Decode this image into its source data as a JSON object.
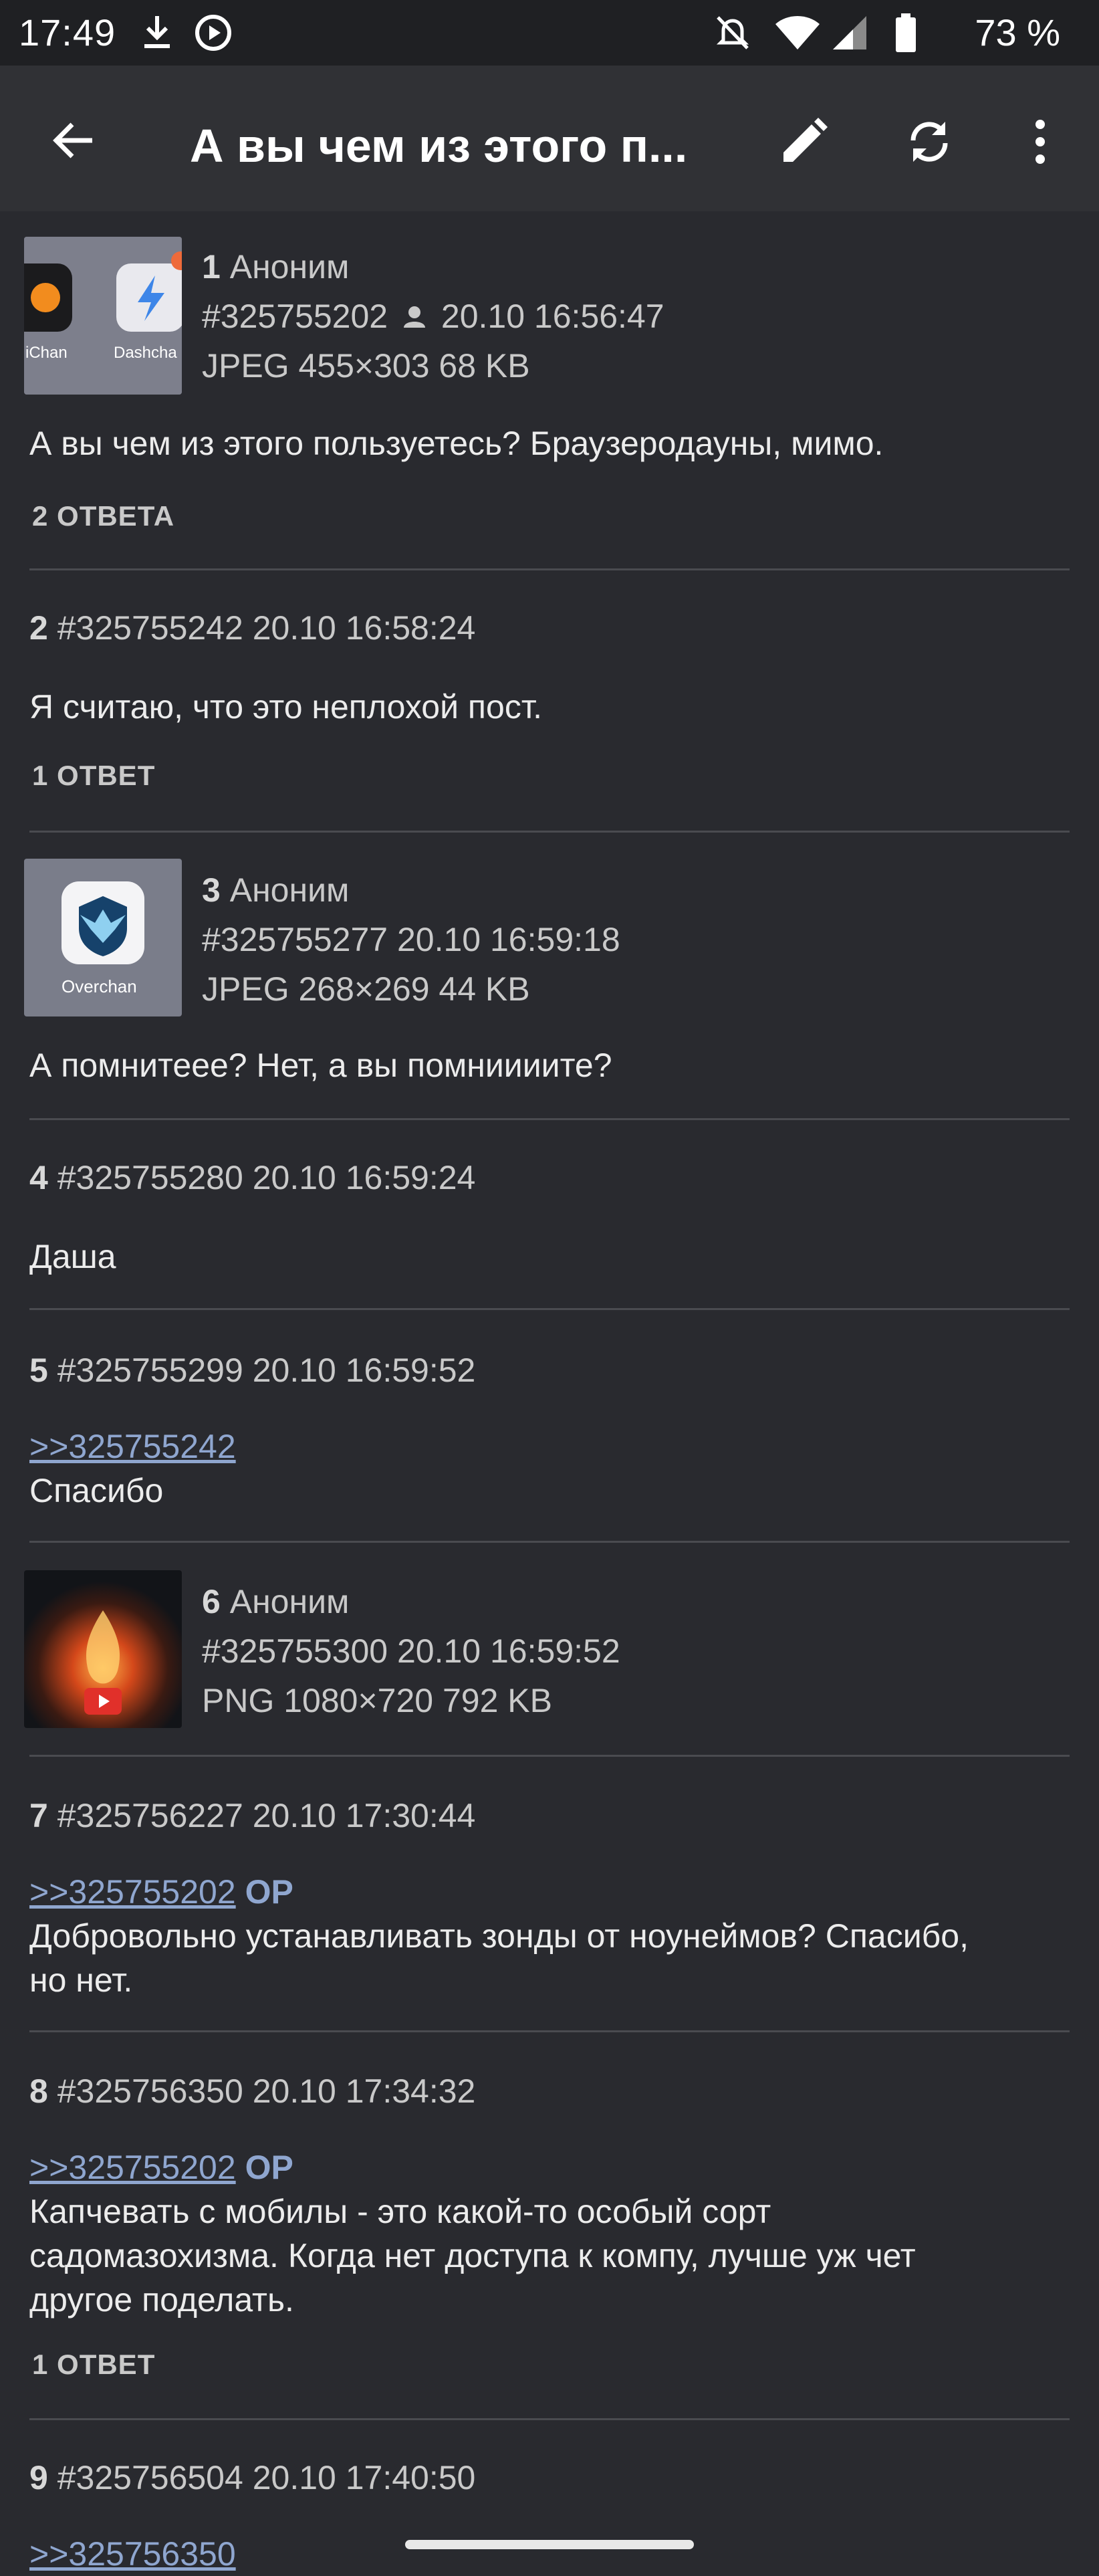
{
  "status_bar": {
    "time": "17:49",
    "battery": "73 %",
    "icons": [
      "download-icon",
      "media-icon",
      "mute-icon",
      "wifi-icon",
      "signal-icon",
      "battery-icon"
    ]
  },
  "app_bar": {
    "title": "А вы чем из этого п...",
    "actions": [
      "back-icon",
      "edit-icon",
      "refresh-icon",
      "more-icon"
    ]
  },
  "posts": [
    {
      "num": "1",
      "author": "Аноним",
      "id": "#325755202",
      "date": "20.10 16:56:47",
      "file": "JPEG 455×303 68 KB",
      "thumb_labels": [
        "iChan",
        "Dashcha"
      ],
      "text": "А вы чем из этого пользуетесь? Браузеродауны, мимо.",
      "replies": "2 ОТВЕТА"
    },
    {
      "num": "2",
      "id": "#325755242",
      "date": "20.10 16:58:24",
      "text": "Я считаю, что это неплохой пост.",
      "replies": "1 ОТВЕТ"
    },
    {
      "num": "3",
      "author": "Аноним",
      "id": "#325755277",
      "date": "20.10 16:59:18",
      "file": "JPEG 268×269 44 KB",
      "thumb_labels": [
        "Overchan"
      ],
      "text": "А помнитеее? Нет, а вы помниииите?"
    },
    {
      "num": "4",
      "id": "#325755280",
      "date": "20.10 16:59:24",
      "text": "Даша"
    },
    {
      "num": "5",
      "id": "#325755299",
      "date": "20.10 16:59:52",
      "quote": ">>325755242",
      "text": "Спасибо"
    },
    {
      "num": "6",
      "author": "Аноним",
      "id": "#325755300",
      "date": "20.10 16:59:52",
      "file": "PNG 1080×720 792 KB"
    },
    {
      "num": "7",
      "id": "#325756227",
      "date": "20.10 17:30:44",
      "quote": ">>325755202",
      "quote_tag": "OP",
      "text": "Добровольно устанавливать зонды от ноунеймов? Спасибо, но нет."
    },
    {
      "num": "8",
      "id": "#325756350",
      "date": "20.10 17:34:32",
      "quote": ">>325755202",
      "quote_tag": "OP",
      "text": "Капчевать с мобилы - это какой-то особый сорт садомазохизма. Когда нет доступа к компу, лучше уж чет другое поделать.",
      "replies": "1 ОТВЕТ"
    },
    {
      "num": "9",
      "id": "#325756504",
      "date": "20.10 17:40:50",
      "quote": ">>325756350"
    }
  ]
}
